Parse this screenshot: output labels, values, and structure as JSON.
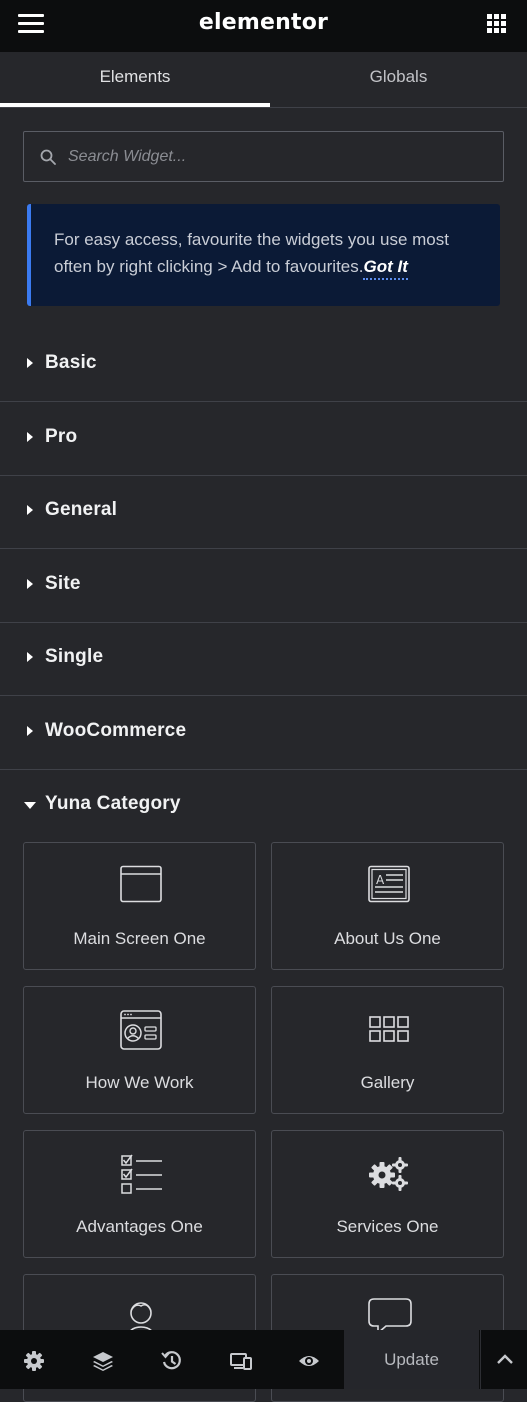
{
  "header": {
    "logo": "elementor",
    "menu_icon": "hamburger-icon",
    "apps_icon": "grid-icon"
  },
  "tabs": [
    {
      "label": "Elements",
      "active": true
    },
    {
      "label": "Globals",
      "active": false
    }
  ],
  "search": {
    "placeholder": "Search Widget...",
    "value": "",
    "icon": "search-icon"
  },
  "notice": {
    "text": "For easy access, favourite the widgets you use most often by right clicking > Add to favourites.",
    "action_label": "Got It"
  },
  "categories": [
    {
      "label": "Basic",
      "open": false
    },
    {
      "label": "Pro",
      "open": false
    },
    {
      "label": "General",
      "open": false
    },
    {
      "label": "Site",
      "open": false
    },
    {
      "label": "Single",
      "open": false
    },
    {
      "label": "WooCommerce",
      "open": false
    },
    {
      "label": "Yuna Category",
      "open": true
    }
  ],
  "widgets": [
    {
      "label": "Main Screen One",
      "icon": "window-icon"
    },
    {
      "label": "About Us One",
      "icon": "text-block-icon"
    },
    {
      "label": "How We Work",
      "icon": "profile-card-icon"
    },
    {
      "label": "Gallery",
      "icon": "gallery-grid-icon"
    },
    {
      "label": "Advantages One",
      "icon": "checklist-icon"
    },
    {
      "label": "Services One",
      "icon": "gears-icon"
    },
    {
      "label": "",
      "icon": "person-icon"
    },
    {
      "label": "",
      "icon": "speech-bubble-icon"
    }
  ],
  "footer": {
    "icons": [
      "settings-icon",
      "layers-icon",
      "history-icon",
      "responsive-icon",
      "preview-eye-icon"
    ],
    "update_label": "Update",
    "expand_icon": "chevron-up-icon"
  },
  "colors": {
    "panel_bg": "#26272b",
    "topbar_bg": "#0c0d0e",
    "notice_bg": "#0b1a36",
    "notice_accent": "#3b7bf1",
    "divider": "#3f4148"
  }
}
